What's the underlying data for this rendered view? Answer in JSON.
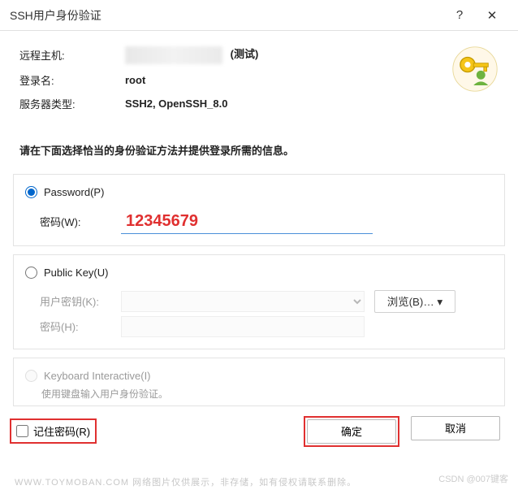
{
  "titlebar": {
    "title": "SSH用户身份验证",
    "help": "?",
    "close": "✕"
  },
  "info": {
    "remote_host_label": "远程主机:",
    "remote_host_suffix": "(测试)",
    "login_label": "登录名:",
    "login_value": "root",
    "server_type_label": "服务器类型:",
    "server_type_value": "SSH2, OpenSSH_8.0"
  },
  "instruction": "请在下面选择恰当的身份验证方法并提供登录所需的信息。",
  "password_section": {
    "radio_label": "Password(P)",
    "pwd_label": "密码(W):",
    "pwd_value": "12345679"
  },
  "pubkey_section": {
    "radio_label": "Public Key(U)",
    "userkey_label": "用户密钥(K):",
    "pwd_label": "密码(H):",
    "browse_label": "浏览(B)…  ▾"
  },
  "ki_section": {
    "radio_label": "Keyboard Interactive(I)",
    "note": "使用键盘输入用户身份验证。"
  },
  "bottom": {
    "remember_label": "记住密码(R)",
    "ok_label": "确定",
    "cancel_label": "取消"
  },
  "watermark": {
    "left": "WWW.TOYMOBAN.COM  网络图片仅供展示，非存储，如有侵权请联系删除。",
    "right": "CSDN @007键客"
  }
}
